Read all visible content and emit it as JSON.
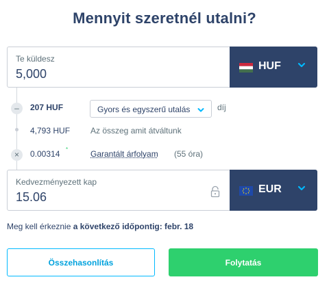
{
  "title": "Mennyit szeretnél utalni?",
  "send": {
    "label": "Te küldesz",
    "amount": "5,000",
    "currency": "HUF",
    "flag_icon": "hungary-flag-icon"
  },
  "fee": {
    "amount": "207 HUF",
    "method": "Gyors és egyszerű utalás",
    "unit": "díj"
  },
  "converted": {
    "amount": "4,793 HUF",
    "label": "Az összeg amit átváltunk"
  },
  "rate": {
    "value": "0.00314",
    "star": "*",
    "link_label": "Garantált árfolyam",
    "hours": "(55 óra)"
  },
  "receive": {
    "label": "Kedvezményezett kap",
    "amount": "15.06",
    "currency": "EUR",
    "flag_icon": "eu-flag-icon"
  },
  "arrival": {
    "prefix": "Meg kell érkeznie",
    "emphasis": "a következő időpontig: febr. 18"
  },
  "buttons": {
    "compare": "Összehasonlítás",
    "continue": "Folytatás"
  },
  "colors": {
    "navy": "#2e4369",
    "green": "#2ed06e",
    "blue": "#00b9ff"
  }
}
